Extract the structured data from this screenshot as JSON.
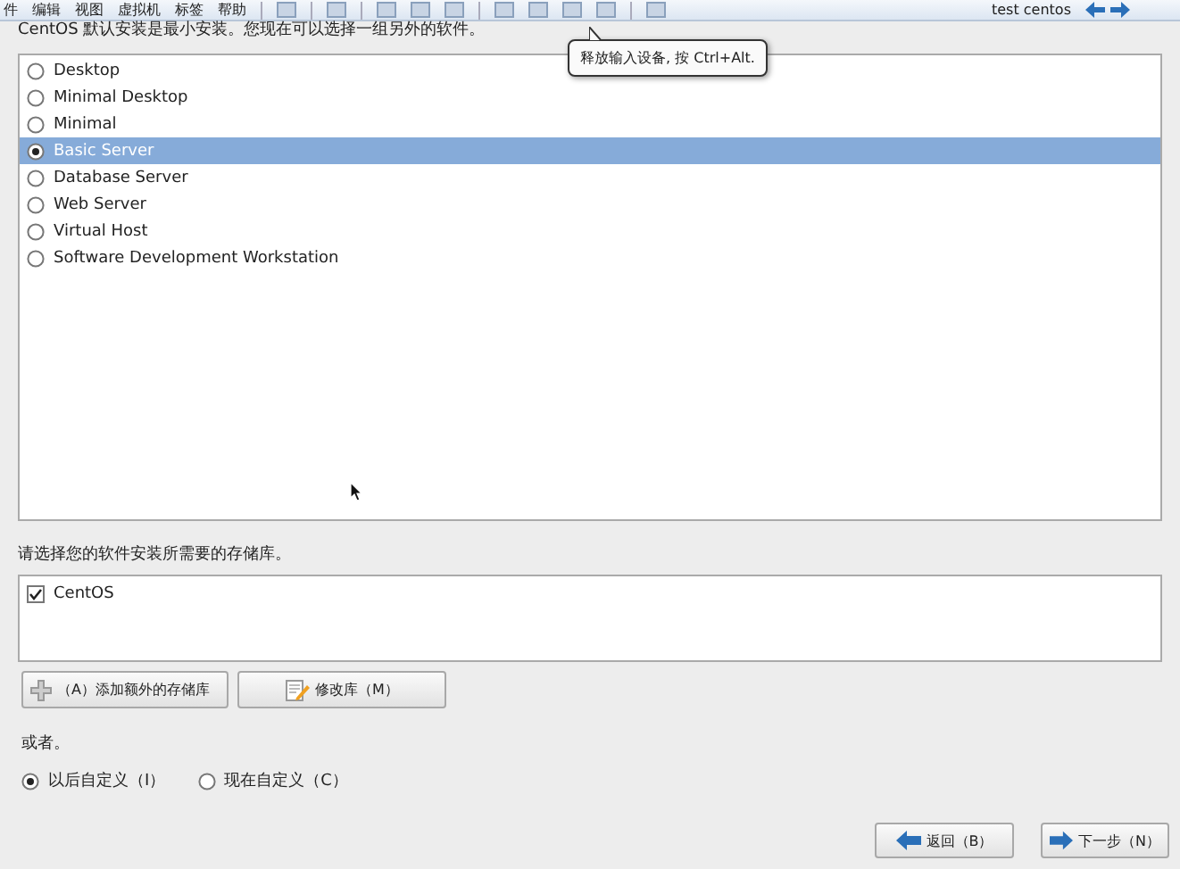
{
  "menu": [
    "件",
    "编辑",
    "视图",
    "虚拟机",
    "标签",
    "帮助"
  ],
  "vm_name": "test centos",
  "tooltip": "释放输入设备, 按 Ctrl+Alt.",
  "subtitle": "CentOS 默认安装是最小安装。您现在可以选择一组另外的软件。",
  "install_options": [
    {
      "label": "Desktop",
      "selected": false
    },
    {
      "label": "Minimal Desktop",
      "selected": false
    },
    {
      "label": "Minimal",
      "selected": false
    },
    {
      "label": "Basic Server",
      "selected": true
    },
    {
      "label": "Database Server",
      "selected": false
    },
    {
      "label": "Web Server",
      "selected": false
    },
    {
      "label": "Virtual Host",
      "selected": false
    },
    {
      "label": "Software Development Workstation",
      "selected": false
    }
  ],
  "repo_prompt": "请选择您的软件安装所需要的存储库。",
  "repositories": [
    {
      "label": "CentOS",
      "checked": true
    }
  ],
  "repo_buttons": [
    {
      "kind": "add",
      "label": "（A）添加额外的存储库"
    },
    {
      "kind": "modify",
      "label": "修改库（M）"
    }
  ],
  "or_label": "或者。",
  "customize_options": [
    {
      "label": "以后自定义（I）",
      "selected": true
    },
    {
      "label": "现在自定义（C）",
      "selected": false
    }
  ],
  "nav_buttons": [
    {
      "kind": "back",
      "label": "返回（B）"
    },
    {
      "kind": "next",
      "label": "下一步（N）"
    }
  ]
}
